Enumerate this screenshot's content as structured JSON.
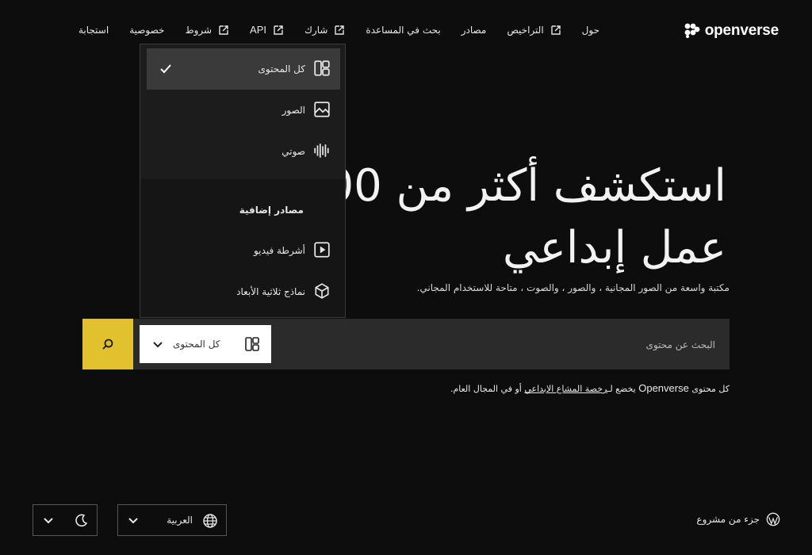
{
  "header": {
    "logo_text": "openverse",
    "nav": [
      {
        "label": "حول",
        "external": false
      },
      {
        "label": "التراخيص",
        "external": true
      },
      {
        "label": "مصادر",
        "external": false
      },
      {
        "label": "بحث في المساعدة",
        "external": false
      },
      {
        "label": "شارك",
        "external": true
      },
      {
        "label": "API",
        "external": true
      },
      {
        "label": "شروط",
        "external": true
      },
      {
        "label": "خصوصية",
        "external": false
      },
      {
        "label": "استجابة",
        "external": false
      }
    ]
  },
  "hero": {
    "title": "استكشف أكثر من 600 مليون عمل إبداعي",
    "subtitle": "مكتبة واسعة من الصور المجانية ، والصور ، والصوت ، متاحة للاستخدام المجاني."
  },
  "search": {
    "placeholder": "البحث عن محتوى",
    "content_type_label": "كل المحتوى"
  },
  "license_note": {
    "prefix": "كل محتوى",
    "brand": "Openverse",
    "middle": "يخضع لـ",
    "link": "رخصة المشاع الإبداعي",
    "suffix": "أو في المجال العام."
  },
  "dropdown": {
    "items": [
      {
        "label": "كل المحتوى",
        "icon": "all-content-icon",
        "selected": true
      },
      {
        "label": "الصور",
        "icon": "image-icon",
        "selected": false
      },
      {
        "label": "صوتي",
        "icon": "audio-icon",
        "selected": false
      }
    ],
    "additional_heading": "مصادر إضافية",
    "additional": [
      {
        "label": "أشرطة فيديو",
        "icon": "video-icon"
      },
      {
        "label": "نماذج ثلاثية الأبعاد",
        "icon": "cube-icon"
      }
    ]
  },
  "footer": {
    "part_of": "جزء من مشروع",
    "language": "العربية"
  },
  "colors": {
    "background": "#0d0d0d",
    "accent": "#e2c12e",
    "search_bar": "#2b2b2b",
    "dropdown_bg": "#1c1c1c",
    "selected_bg": "#3a3a3a"
  }
}
